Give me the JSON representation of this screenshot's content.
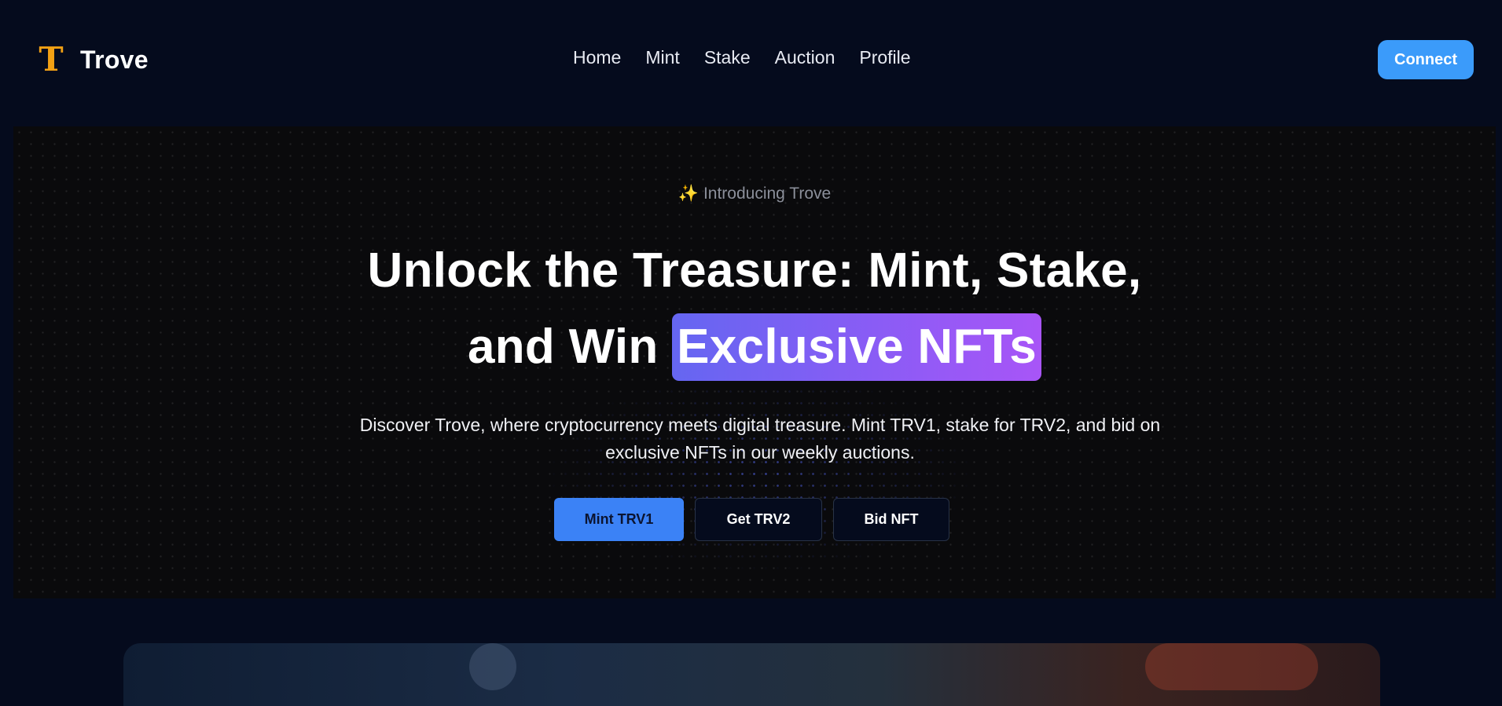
{
  "brand": {
    "logo_letter": "T",
    "name": "Trove",
    "logo_color": "#f2a114"
  },
  "nav": {
    "links": [
      {
        "label": "Home"
      },
      {
        "label": "Mint"
      },
      {
        "label": "Stake"
      },
      {
        "label": "Auction"
      },
      {
        "label": "Profile"
      }
    ],
    "connect_label": "Connect"
  },
  "hero": {
    "eyebrow_icon": "sparkles-icon",
    "eyebrow_text": "Introducing Trove",
    "headline_line1": "Unlock the Treasure: Mint, Stake,",
    "headline_line2_prefix": "and Win",
    "headline_highlight": "Exclusive NFTs",
    "subtext": "Discover Trove, where cryptocurrency meets digital treasure. Mint TRV1, stake for TRV2, and bid on exclusive NFTs in our weekly auctions.",
    "buttons": {
      "primary": "Mint TRV1",
      "secondary": "Get TRV2",
      "tertiary": "Bid NFT"
    }
  },
  "colors": {
    "background": "#050b1d",
    "accent_blue": "#3b82f6",
    "connect_blue": "#3b9bfa",
    "highlight_gradient_start": "#6566f1",
    "highlight_gradient_end": "#a855f7"
  }
}
